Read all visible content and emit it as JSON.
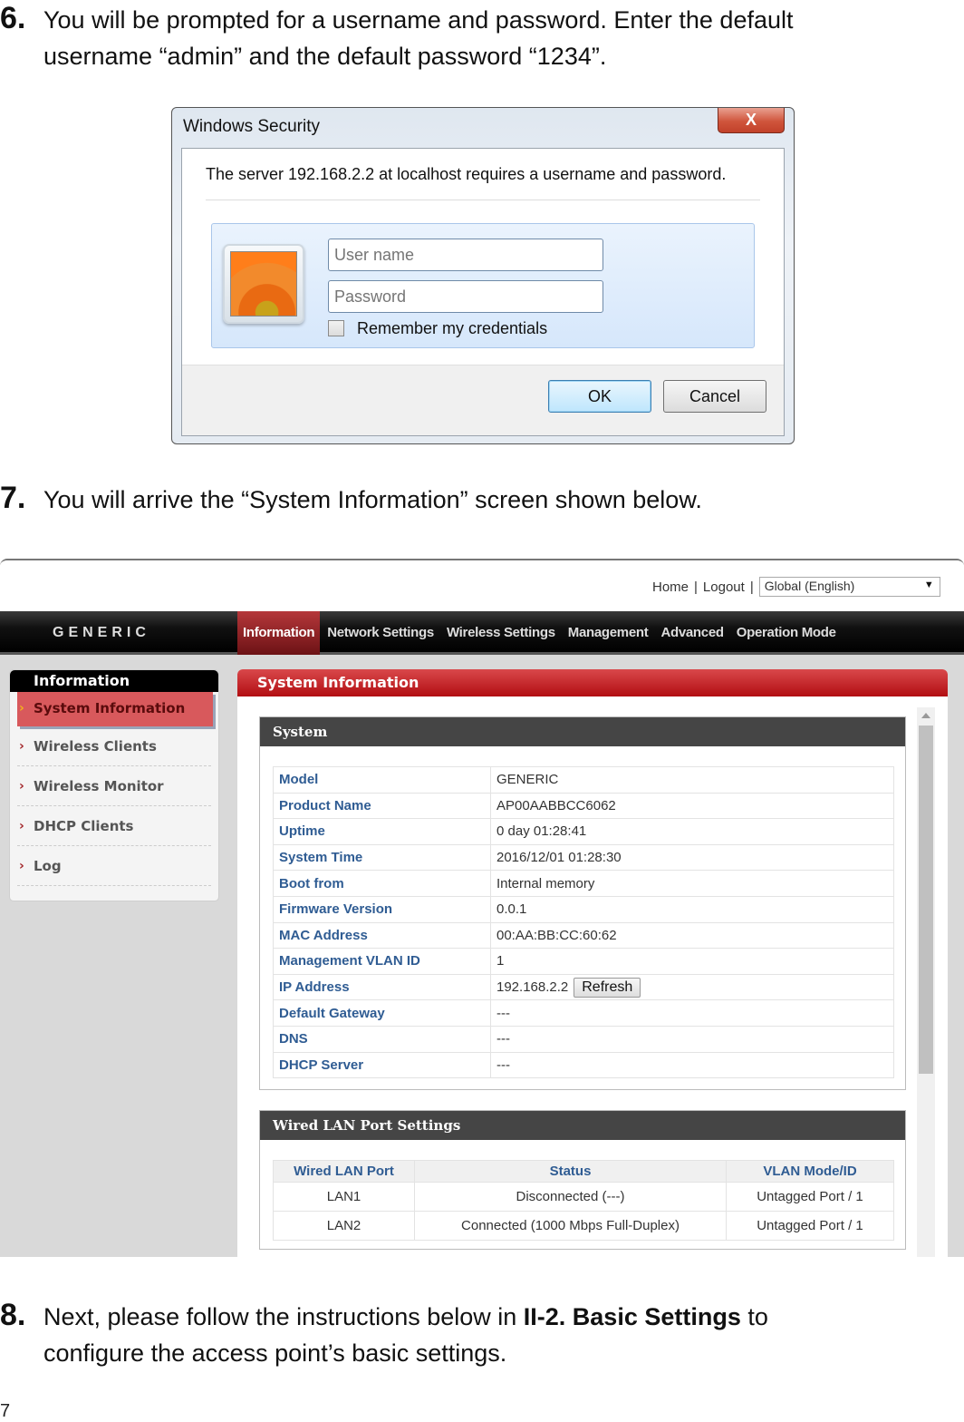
{
  "steps": {
    "s6": {
      "num": "6.",
      "line1": "You will be prompted for a username and password. Enter the default",
      "line2": "username “admin” and the default password “1234”."
    },
    "s7": {
      "num": "7.",
      "line1": "You will arrive the “System Information” screen shown below."
    },
    "s8": {
      "num": "8.",
      "pre": "Next, please follow the instructions below in ",
      "bold": "II-2. Basic Settings",
      "post": " to",
      "line2": "configure the access point’s basic settings."
    }
  },
  "page_number": "7",
  "dialog": {
    "title": "Windows Security",
    "close_glyph": "X",
    "message": "The server 192.168.2.2 at localhost requires a username and password.",
    "username_placeholder": "User name",
    "password_placeholder": "Password",
    "remember_label": "Remember my credentials",
    "ok_label": "OK",
    "cancel_label": "Cancel"
  },
  "router": {
    "top_links": {
      "home": "Home",
      "separator": "|",
      "logout": "Logout"
    },
    "language": {
      "selected": "Global (English)",
      "arrow": "▼"
    },
    "brand": "GENERIC",
    "nav": [
      "Information",
      "Network Settings",
      "Wireless Settings",
      "Management",
      "Advanced",
      "Operation Mode"
    ],
    "sidebar": {
      "heading": "Information",
      "chevron": "›",
      "items": [
        "System Information",
        "Wireless Clients",
        "Wireless Monitor",
        "DHCP Clients",
        "Log"
      ]
    },
    "panel_title": "System Information",
    "system": {
      "heading": "System",
      "rows": [
        {
          "label": "Model",
          "value": "GENERIC"
        },
        {
          "label": "Product Name",
          "value": "AP00AABBCC6062"
        },
        {
          "label": "Uptime",
          "value": " 0 day 01:28:41"
        },
        {
          "label": "System Time",
          "value": "2016/12/01 01:28:30"
        },
        {
          "label": "Boot from",
          "value": "Internal memory"
        },
        {
          "label": "Firmware Version",
          "value": "0.0.1"
        },
        {
          "label": "MAC Address",
          "value": "00:AA:BB:CC:60:62"
        },
        {
          "label": "Management VLAN ID",
          "value": "1"
        },
        {
          "label": "IP Address",
          "value": "192.168.2.2"
        },
        {
          "label": "Default Gateway",
          "value": "---"
        },
        {
          "label": "DNS",
          "value": "---"
        },
        {
          "label": "DHCP Server",
          "value": "---"
        }
      ],
      "refresh_label": "Refresh"
    },
    "wired": {
      "heading": "Wired LAN Port Settings",
      "columns": [
        "Wired LAN Port",
        "Status",
        "VLAN Mode/ID"
      ],
      "rows": [
        [
          "LAN1",
          "Disconnected (---)",
          "Untagged Port /  1"
        ],
        [
          "LAN2",
          "Connected (1000 Mbps Full-Duplex)",
          "Untagged Port /  1"
        ]
      ]
    }
  }
}
